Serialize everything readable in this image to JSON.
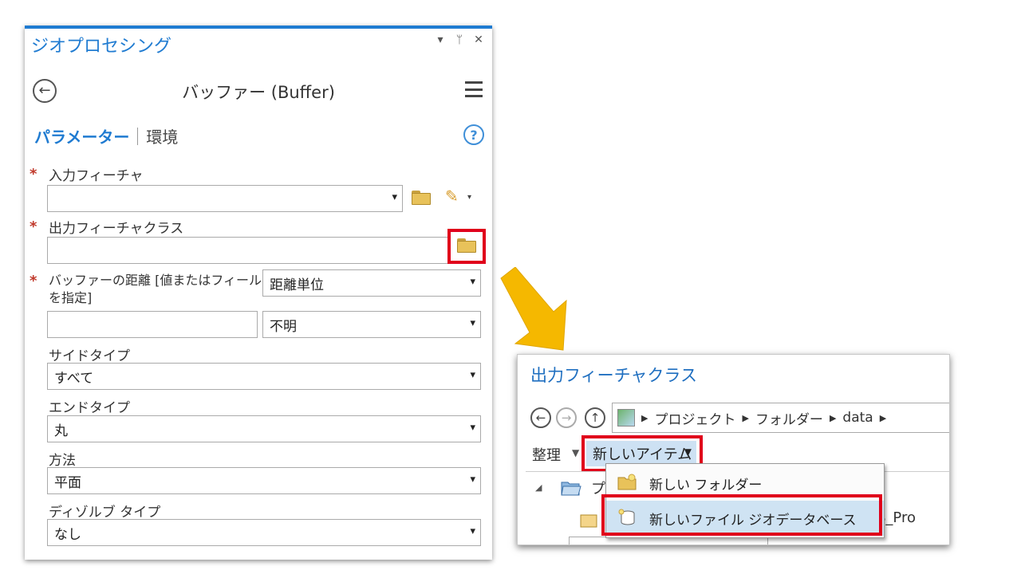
{
  "geoprocessing": {
    "title": "ジオプロセシング",
    "controls": [
      "▾",
      "ᛘ",
      "✕"
    ],
    "tool_title": "バッファー (Buffer)",
    "back_icon": "back-arrow-icon",
    "menu_icon": "hamburger-menu-icon",
    "tabs": {
      "parameters": "パラメーター",
      "environments": "環境"
    },
    "help_icon": "?",
    "params": {
      "input_features": {
        "label": "入力フィーチャ",
        "value": ""
      },
      "output_fc": {
        "label": "出力フィーチャクラス",
        "value": ""
      },
      "buffer_distance": {
        "label_line1": "バッファーの距離 [値またはフィールド",
        "label_line2": "を指定]",
        "mode_value": "距離単位",
        "distance_value": "",
        "unit_value": "不明"
      },
      "side_type": {
        "label": "サイドタイプ",
        "value": "すべて"
      },
      "end_type": {
        "label": "エンドタイプ",
        "value": "丸"
      },
      "method": {
        "label": "方法",
        "value": "平面"
      },
      "dissolve_type": {
        "label": "ディゾルブ タイプ",
        "value": "なし"
      }
    },
    "required_marker": "*"
  },
  "dialog": {
    "title": "出力フィーチャクラス",
    "breadcrumb": [
      "プロジェクト",
      "フォルダー",
      "data"
    ],
    "organize": "整理",
    "new_item": "新しいアイテム",
    "menu_items": [
      "新しい フォルダー",
      "新しいファイル ジオデータベース"
    ],
    "tree_label": "プ",
    "tree_right_text": "S_Pro"
  },
  "colors": {
    "accent": "#1f7bd1",
    "highlight": "#e0001b",
    "arrow": "#f5b800"
  }
}
